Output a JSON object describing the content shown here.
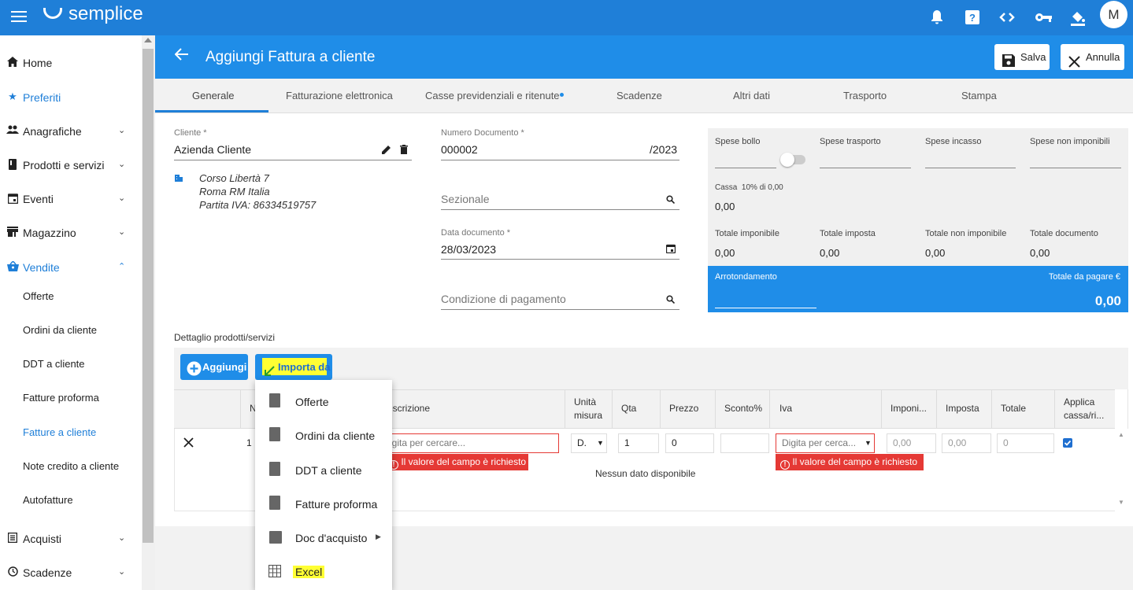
{
  "app": {
    "logo": "semplice",
    "avatar": "M",
    "icons": [
      "bell-icon",
      "help-icon",
      "code-icon",
      "key-icon",
      "paint-bucket-icon"
    ]
  },
  "sidebar": {
    "items": [
      {
        "label": "Home",
        "icon": "home-icon"
      },
      {
        "label": "Preferiti",
        "icon": "star-icon"
      },
      {
        "label": "Anagrafiche",
        "icon": "people-icon"
      },
      {
        "label": "Prodotti e servizi",
        "icon": "book-icon"
      },
      {
        "label": "Eventi",
        "icon": "calendar-icon"
      },
      {
        "label": "Magazzino",
        "icon": "store-icon"
      },
      {
        "label": "Vendite",
        "icon": "basket-icon"
      },
      {
        "label": "Acquisti",
        "icon": "list-icon"
      },
      {
        "label": "Scadenze",
        "icon": "clock-icon"
      }
    ],
    "sub": [
      "Offerte",
      "Ordini da cliente",
      "DDT a cliente",
      "Fatture proforma",
      "Fatture a cliente",
      "Note credito a cliente",
      "Autofatture"
    ]
  },
  "header": {
    "title": "Aggiungi Fattura a cliente",
    "save": "Salva",
    "cancel": "Annulla"
  },
  "tabs": [
    "Generale",
    "Fatturazione elettronica",
    "Casse previdenziali e ritenute",
    "Scadenze",
    "Altri dati",
    "Trasporto",
    "Stampa"
  ],
  "form": {
    "cliente_label": "Cliente *",
    "cliente": "Azienda Cliente",
    "address": [
      "Corso Libertà 7",
      "Roma RM Italia",
      "Partita IVA: 86334519757"
    ],
    "numero_label": "Numero Documento *",
    "numero": "000002",
    "anno": "/2023",
    "sezionale": "Sezionale",
    "data_label": "Data documento *",
    "data": "28/03/2023",
    "condizione": "Condizione di pagamento"
  },
  "totals": {
    "spese_bollo": "Spese bollo",
    "spese_trasporto": "Spese trasporto",
    "spese_incasso": "Spese incasso",
    "spese_non_imponibili": "Spese non imponibili",
    "cassa_label": "Cassa",
    "cassa_pct": "10% di 0,00",
    "cassa_val": "0,00",
    "tot_imponibile": "Totale imponibile",
    "tot_imponibile_val": "0,00",
    "tot_imposta": "Totale imposta",
    "tot_imposta_val": "0,00",
    "tot_non_imponibile": "Totale non imponibile",
    "tot_non_imponibile_val": "0,00",
    "tot_documento": "Totale documento",
    "tot_documento_val": "0,00",
    "arrotondamento": "Arrotondamento",
    "totale_pagare": "Totale da pagare €",
    "totale_pagare_val": "0,00"
  },
  "detail": {
    "title": "Dettaglio prodotti/servizi",
    "add": "Aggiungi",
    "import": "Importa da",
    "columns": [
      "N",
      "escrizione",
      "Unità misura",
      "Qta",
      "Prezzo",
      "Sconto%",
      "Iva",
      "Imponi...",
      "Imposta",
      "Totale",
      "Applica cassa/ri..."
    ],
    "row": {
      "n": "1",
      "desc_ph": "igita per cercare...",
      "um": "D.",
      "qta": "1",
      "prezzo": "0",
      "iva_ph": "Digita per cerca...",
      "imponibile": "0,00",
      "imposta": "0,00",
      "totale": "0"
    },
    "error": "Il valore del campo è richiesto",
    "empty": "Nessun dato disponibile"
  },
  "menu": [
    "Offerte",
    "Ordini da cliente",
    "DDT a cliente",
    "Fatture proforma",
    "Doc d'acquisto",
    "Excel"
  ]
}
